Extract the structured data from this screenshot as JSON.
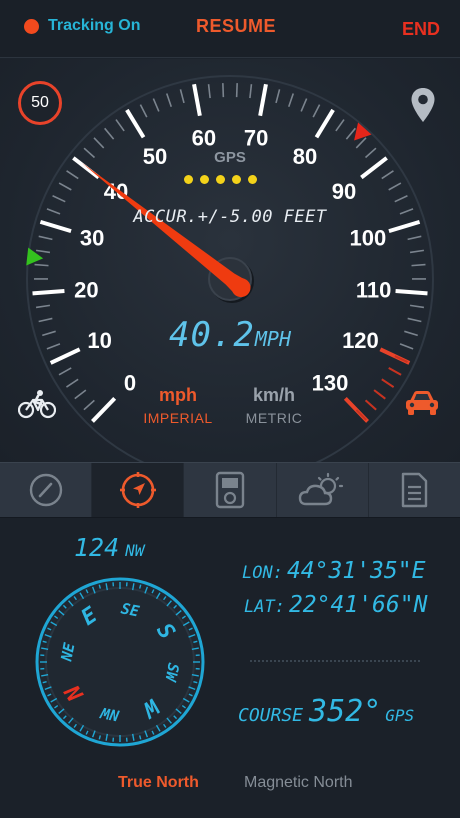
{
  "topbar": {
    "tracking_label": "Tracking On",
    "resume_label": "RESUME",
    "end_label": "END"
  },
  "gauge": {
    "speed_limit": "50",
    "ticks": [
      "0",
      "10",
      "20",
      "30",
      "40",
      "50",
      "60",
      "70",
      "80",
      "90",
      "100",
      "110",
      "120",
      "130"
    ],
    "max_value": 130,
    "needle_value": 40.2,
    "warning_zone_start": 120,
    "limit_marker_value": 85,
    "secondary_marker_value": 25,
    "gps_label": "GPS",
    "gps_signal_bars": 5,
    "accuracy_text": "ACCUR.+/-5.00 FEET",
    "speed_value": "40.2",
    "speed_unit": "MPH",
    "units": {
      "imperial_unit": "mph",
      "imperial_label": "IMPERIAL",
      "metric_unit": "km/h",
      "metric_label": "METRIC",
      "selected": "imperial"
    }
  },
  "icons": {
    "location": "map-pin-icon",
    "bike_mode": "bicycle-icon",
    "car_mode": "car-icon"
  },
  "tabs": [
    {
      "id": "speedometer",
      "icon": "speedometer-icon"
    },
    {
      "id": "compass",
      "icon": "compass-navigation-icon",
      "active": true
    },
    {
      "id": "media",
      "icon": "music-player-icon"
    },
    {
      "id": "weather",
      "icon": "weather-icon"
    },
    {
      "id": "notes",
      "icon": "document-icon"
    }
  ],
  "compass": {
    "heading_value": "124",
    "heading_dir": "NW",
    "rotation_deg": -124,
    "cardinals": [
      "N",
      "NE",
      "E",
      "SE",
      "S",
      "SW",
      "W",
      "NW"
    ],
    "lon_label": "LON:",
    "lon_value": "44°31'35\"E",
    "lat_label": "LAT:",
    "lat_value": "22°41'66\"N",
    "course_label": "COURSE",
    "course_value": "352°",
    "course_source": "GPS",
    "true_north_label": "True North",
    "magnetic_north_label": "Magnetic North",
    "selected_reference": "true"
  },
  "colors": {
    "accent_orange": "#ee5a2c",
    "accent_cyan": "#32b9e4",
    "end_red": "#e83020",
    "gps_yellow": "#f3d21a",
    "background": "#1c232c"
  }
}
